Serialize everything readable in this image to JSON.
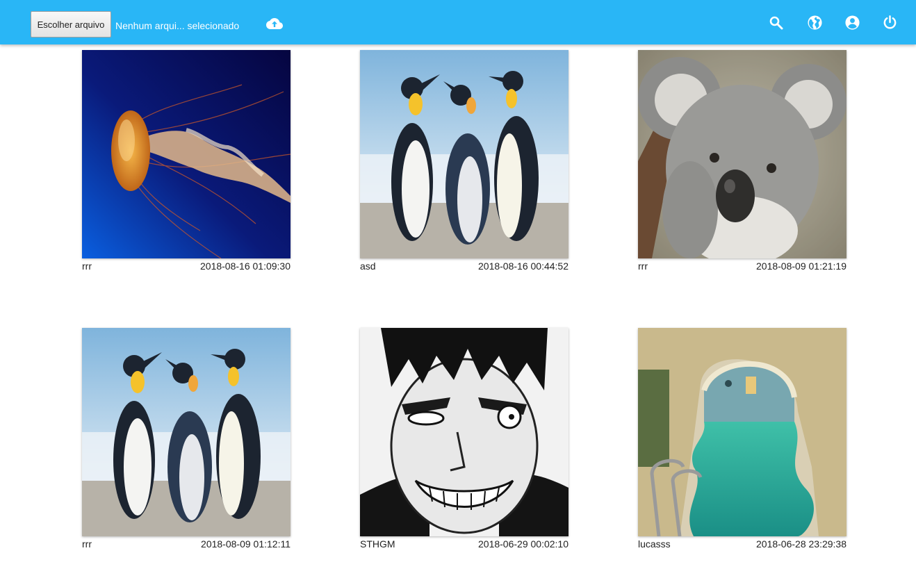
{
  "toolbar": {
    "choose_file_label": "Escolher arquivo",
    "file_status": "Nenhum arqui... selecionado",
    "upload_icon": "cloud-upload-icon",
    "search_icon": "search-icon",
    "globe_icon": "globe-icon",
    "account_icon": "account-circle-icon",
    "power_icon": "power-icon",
    "bar_color": "#29b6f6"
  },
  "gallery": {
    "items": [
      {
        "name": "rrr",
        "date": "2018-08-16 01:09:30",
        "image": "jellyfish"
      },
      {
        "name": "asd",
        "date": "2018-08-16 00:44:52",
        "image": "penguins"
      },
      {
        "name": "rrr",
        "date": "2018-08-09 01:21:19",
        "image": "koala"
      },
      {
        "name": "rrr",
        "date": "2018-08-09 01:12:11",
        "image": "penguins"
      },
      {
        "name": "STHGM",
        "date": "2018-06-29 00:02:10",
        "image": "manga-face"
      },
      {
        "name": "lucasss",
        "date": "2018-06-28 23:29:38",
        "image": "indoor-pool"
      }
    ]
  }
}
